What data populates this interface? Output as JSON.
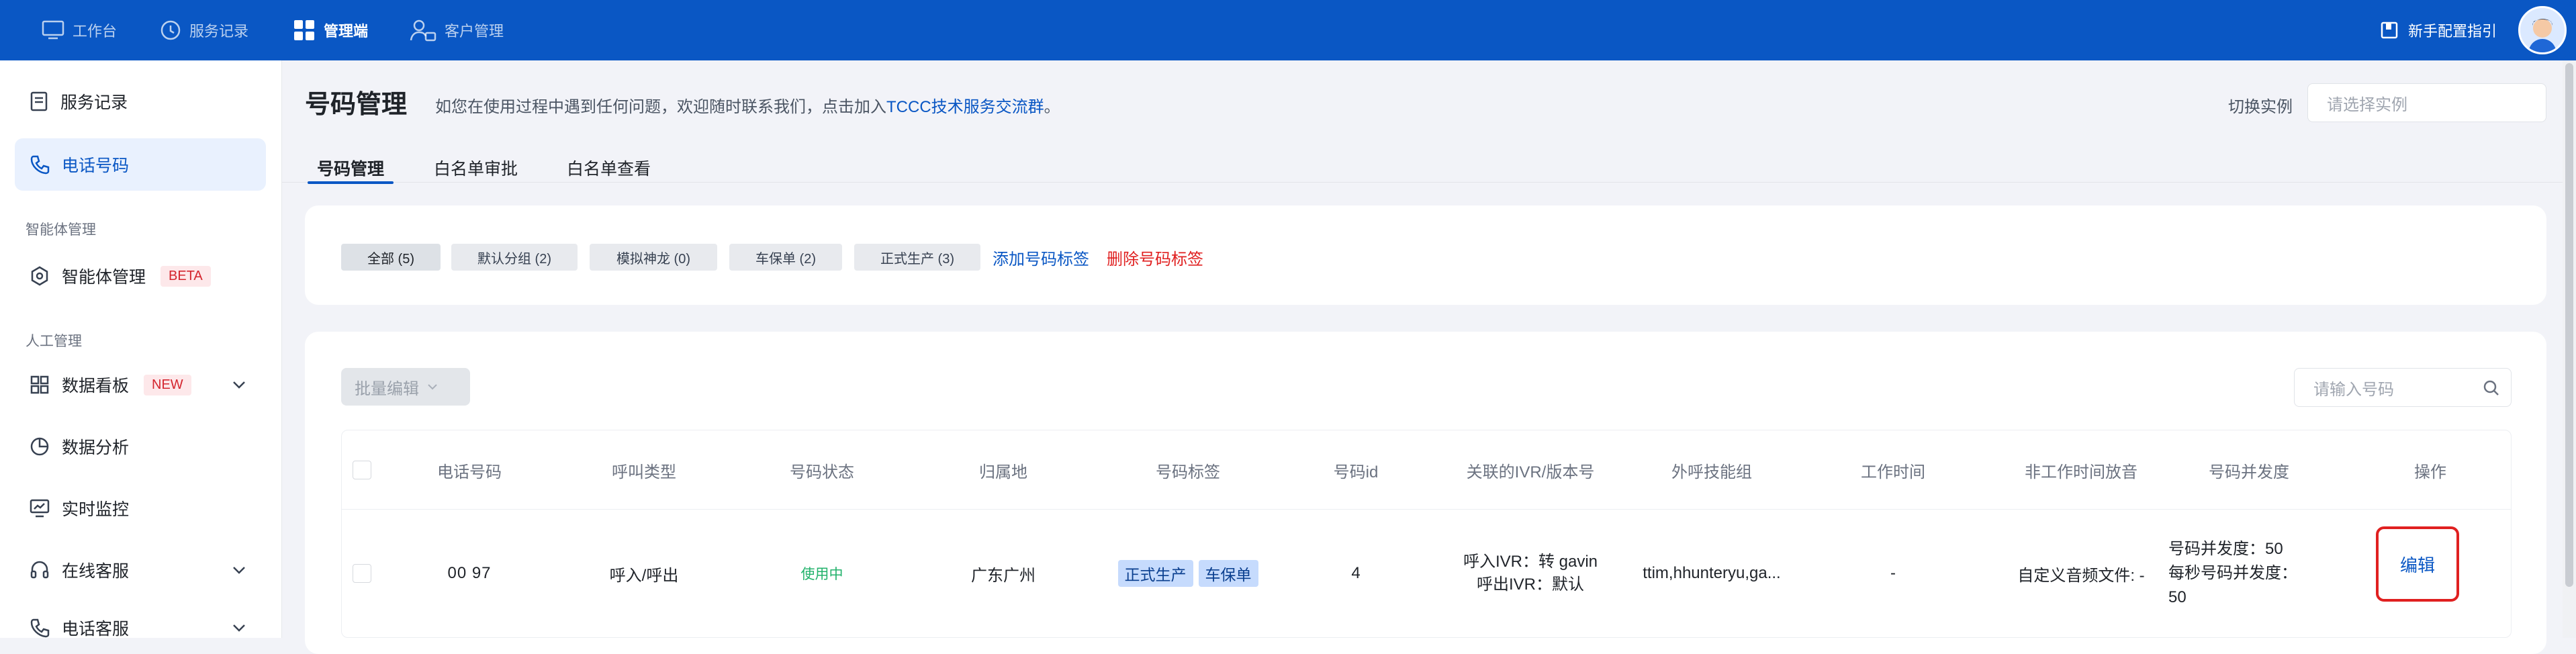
{
  "topnav": {
    "items": [
      {
        "label": "工作台",
        "icon": "monitor-icon"
      },
      {
        "label": "服务记录",
        "icon": "clock-icon"
      },
      {
        "label": "管理端",
        "icon": "grid-icon"
      },
      {
        "label": "客户管理",
        "icon": "user-card-icon"
      }
    ],
    "guide_label": "新手配置指引",
    "colors": {
      "bar": "#0a57c4"
    }
  },
  "sidebar": {
    "items": [
      {
        "label": "服务记录"
      },
      {
        "label": "电话号码"
      }
    ],
    "group_agent": "智能体管理",
    "agent_item": {
      "label": "智能体管理",
      "badge": "BETA"
    },
    "group_human": "人工管理",
    "human_items": [
      {
        "label": "数据看板",
        "badge": "NEW"
      },
      {
        "label": "数据分析"
      },
      {
        "label": "实时监控"
      },
      {
        "label": "在线客服"
      },
      {
        "label": "电话客服"
      }
    ]
  },
  "header": {
    "title": "号码管理",
    "desc_prefix": "如您在使用过程中遇到任何问题，欢迎随时联系我们，点击加入",
    "desc_link": "TCCC技术服务交流群",
    "desc_suffix": "。",
    "switch_label": "切换实例",
    "switch_placeholder": "请选择实例"
  },
  "tabs": [
    {
      "label": "号码管理"
    },
    {
      "label": "白名单审批"
    },
    {
      "label": "白名单查看"
    }
  ],
  "filter_tags": [
    {
      "label": "全部 (5)"
    },
    {
      "label": "默认分组 (2)"
    },
    {
      "label": "模拟神龙 (0)"
    },
    {
      "label": "车保单 (2)"
    },
    {
      "label": "正式生产 (3)"
    }
  ],
  "tag_actions": {
    "add": "添加号码标签",
    "delete": "删除号码标签"
  },
  "toolbar": {
    "batch_edit": "批量编辑",
    "search_placeholder": "请输入号码"
  },
  "table": {
    "headers": [
      "电话号码",
      "呼叫类型",
      "号码状态",
      "归属地",
      "号码标签",
      "号码id",
      "关联的IVR/版本号",
      "外呼技能组",
      "工作时间",
      "非工作时间放音",
      "号码并发度",
      "操作"
    ],
    "row": {
      "phone": "00       97",
      "call_type": "呼入/呼出",
      "status": "使用中",
      "location": "广东广州",
      "tags": [
        "正式生产",
        "车保单"
      ],
      "id": "4",
      "ivr_in": "呼入IVR：转 gavin",
      "ivr_out": "呼出IVR：默认",
      "skill_group": "ttim,hhunteryu,ga...",
      "work_time": "-",
      "off_audio": "自定义音频文件: -",
      "concurrency": "号码并发度：50",
      "per_second_label": "每秒号码并发度：",
      "per_second_value": "50",
      "action": "编辑"
    }
  }
}
